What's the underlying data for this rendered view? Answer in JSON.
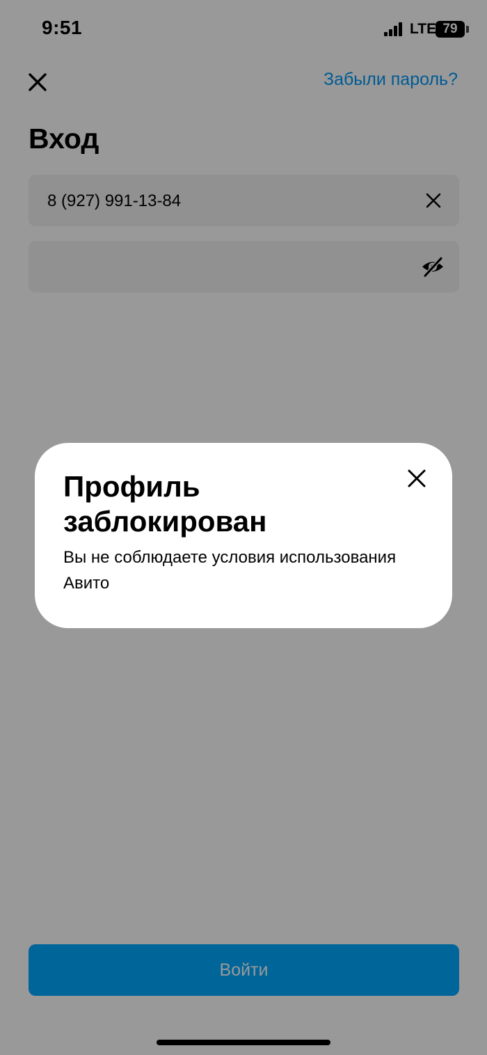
{
  "status_bar": {
    "time": "9:51",
    "network": "LTE",
    "battery": "79"
  },
  "header": {
    "forgot_password": "Забыли пароль?",
    "title": "Вход"
  },
  "form": {
    "phone_value": "8 (927) 991-13-84",
    "password_value": ""
  },
  "modal": {
    "title": "Профиль заблокирован",
    "text": "Вы не соблюдаете условия использования Авито"
  },
  "login_button": "Войти",
  "colors": {
    "accent": "#00a8ff",
    "link": "#0097f5"
  },
  "icons": {
    "close": "close-icon",
    "clear": "clear-icon",
    "eye_off": "eye-off-icon"
  }
}
